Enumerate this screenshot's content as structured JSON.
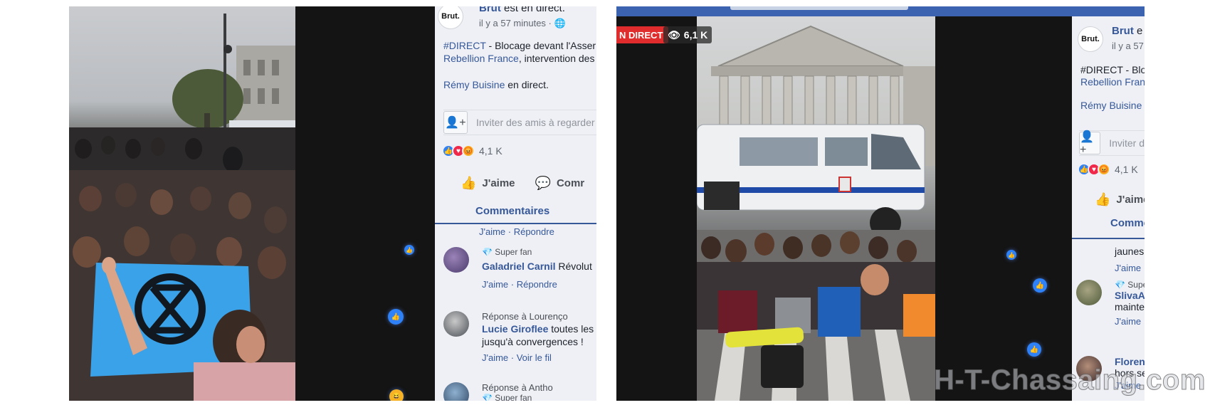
{
  "left": {
    "post": {
      "page_name": "Brut",
      "status_suffix": "est en direct.",
      "time": "il y a 57 minutes",
      "text_line1": "#DIRECT - Blocage devant l'Asser",
      "text_line2_link": "Rebellion France",
      "text_line2_rest": ", intervention des",
      "reporter_link": "Rémy Buisine",
      "reporter_suffix": " en direct.",
      "invite_label": "Inviter des amis à regarder",
      "reaction_count": "4,1 K",
      "like_label": "J'aime",
      "comment_label": "Comr",
      "comments_tab": "Commentaires"
    },
    "comments": [
      {
        "links": "J'aime · Répondre"
      },
      {
        "badge": "Super fan",
        "author": "Galadriel Carnil",
        "text": " Révolut",
        "links": "J'aime · Répondre"
      },
      {
        "reply_to": "Réponse à Lourenço",
        "author": "Lucie Giroflee",
        "text": " toutes les",
        "text2": "jusqu'à convergences !",
        "links": "J'aime · Voir le fil"
      },
      {
        "reply_to": "Réponse à Antho",
        "badge": "Super fan"
      }
    ]
  },
  "right": {
    "live_badge": "N DIRECT",
    "viewers": "6,1 K",
    "post": {
      "page_name": "Brut",
      "status_suffix": " e",
      "time": "il y a 57",
      "text_line1": "#DIRECT - Bloc",
      "text_line2_link": "Rebellion Franc",
      "reporter_link": "Rémy Buisine",
      "reporter_suffix": " e",
      "invite_label": "Inviter d",
      "reaction_count": "4,1 K",
      "like_label": "J'aime",
      "comments_tab": "Comme"
    },
    "comments": [
      {
        "text": "jaunes",
        "links": "J'aime"
      },
      {
        "badge": "Supe",
        "author": "SlivaAp",
        "text": "mainter",
        "links": "J'aime ·"
      },
      {
        "author": "Florenc",
        "text": "hors se",
        "links": "J'aime ·"
      }
    ]
  },
  "watermark": "H-T-Chassaing.com",
  "colors": {
    "facebook_blue": "#365899",
    "like_blue": "#2e81f7",
    "live_red": "#e02c2c",
    "extinction_rebellion_flag": "#3aa2e8"
  },
  "icons": [
    "like-reaction-icon",
    "love-reaction-icon",
    "angry-reaction-icon",
    "add-friend-icon",
    "thumbs-up-icon",
    "comment-icon",
    "eye-icon",
    "globe-icon",
    "diamond-icon"
  ]
}
